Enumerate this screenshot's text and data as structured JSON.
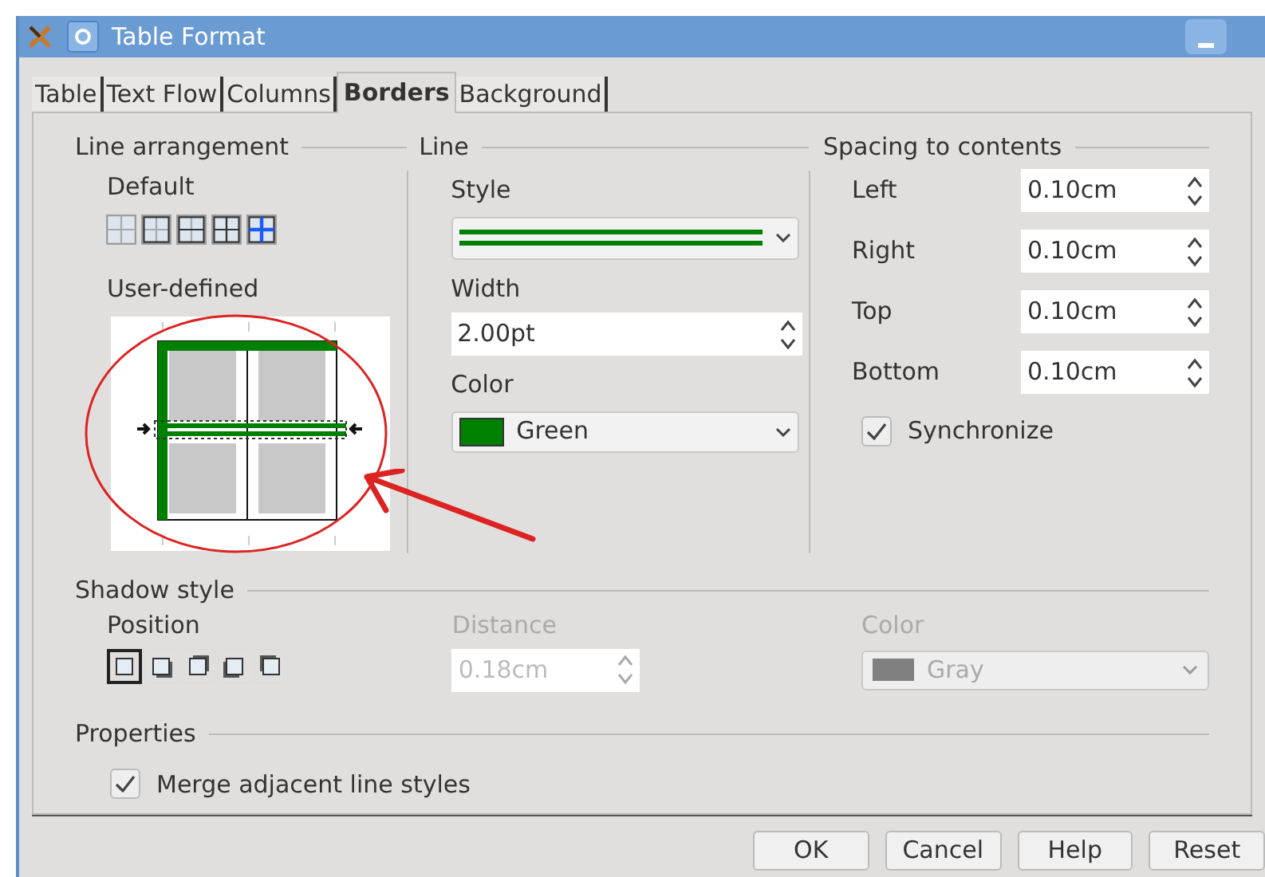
{
  "window": {
    "title": "Table Format"
  },
  "tabs": [
    {
      "label": "Table",
      "selected": false
    },
    {
      "label": "Text Flow",
      "selected": false
    },
    {
      "label": "Columns",
      "selected": false
    },
    {
      "label": "Borders",
      "selected": true
    },
    {
      "label": "Background",
      "selected": false
    }
  ],
  "line_arrangement": {
    "title": "Line arrangement",
    "default_label": {
      "text": "Default"
    },
    "user_defined_label": {
      "text": "User-defined"
    }
  },
  "line": {
    "title": "Line",
    "style": {
      "text": "Style"
    },
    "width": {
      "text": "Width",
      "value": "2.00pt"
    },
    "color": {
      "text": "Color",
      "value": "Green"
    }
  },
  "spacing": {
    "title": "Spacing to contents",
    "fields": [
      {
        "text": "Left",
        "value": "0.10cm"
      },
      {
        "text": "Right",
        "value": "0.10cm"
      },
      {
        "text": "Top",
        "value": "0.10cm"
      },
      {
        "text": "Bottom",
        "value": "0.10cm"
      }
    ],
    "synchronize": {
      "text": "Synchronize",
      "checked": true
    }
  },
  "shadow": {
    "title": "Shadow style",
    "position": {
      "text": "Position",
      "options": [
        {
          "selected": true
        },
        {
          "selected": false
        },
        {
          "selected": false
        },
        {
          "selected": false
        },
        {
          "selected": false
        }
      ]
    },
    "distance": {
      "text": "Distance",
      "value": "0.18cm",
      "disabled": true
    },
    "color": {
      "text": "Color",
      "value": "Gray",
      "disabled": true
    }
  },
  "properties": {
    "title": "Properties",
    "merge": {
      "text": "Merge adjacent line styles",
      "checked": true
    }
  },
  "buttons": [
    {
      "text": "OK"
    },
    {
      "text": "Cancel"
    },
    {
      "text": "Help"
    },
    {
      "text": "Reset"
    }
  ]
}
